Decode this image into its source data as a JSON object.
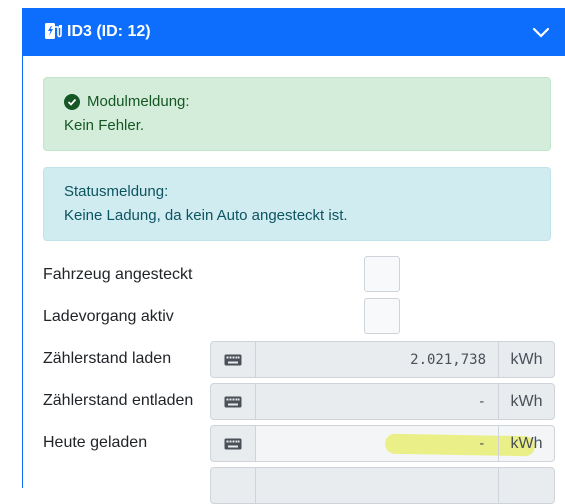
{
  "header": {
    "title": "ID3 (ID: 12)",
    "icon": "charging-station-icon",
    "toggle_icon": "chevron-down-icon"
  },
  "module_alert": {
    "title": "Modulmeldung:",
    "message": "Kein Fehler."
  },
  "status_alert": {
    "title": "Statusmeldung:",
    "message": "Keine Ladung, da kein Auto angesteckt ist."
  },
  "checks": [
    {
      "label": "Fahrzeug angesteckt",
      "checked": false
    },
    {
      "label": "Ladevorgang aktiv",
      "checked": false
    }
  ],
  "meters": [
    {
      "label": "Zählerstand laden",
      "value": "2.021,738",
      "unit": "kWh"
    },
    {
      "label": "Zählerstand entladen",
      "value": "-",
      "unit": "kWh"
    },
    {
      "label": "Heute geladen",
      "value": "-",
      "unit": "kWh"
    },
    {
      "label": "",
      "value": "",
      "unit": ""
    }
  ],
  "colors": {
    "primary": "#0d6efd",
    "success_bg": "#d4edda",
    "info_bg": "#d1ecf1",
    "highlight": "#ecf000"
  }
}
